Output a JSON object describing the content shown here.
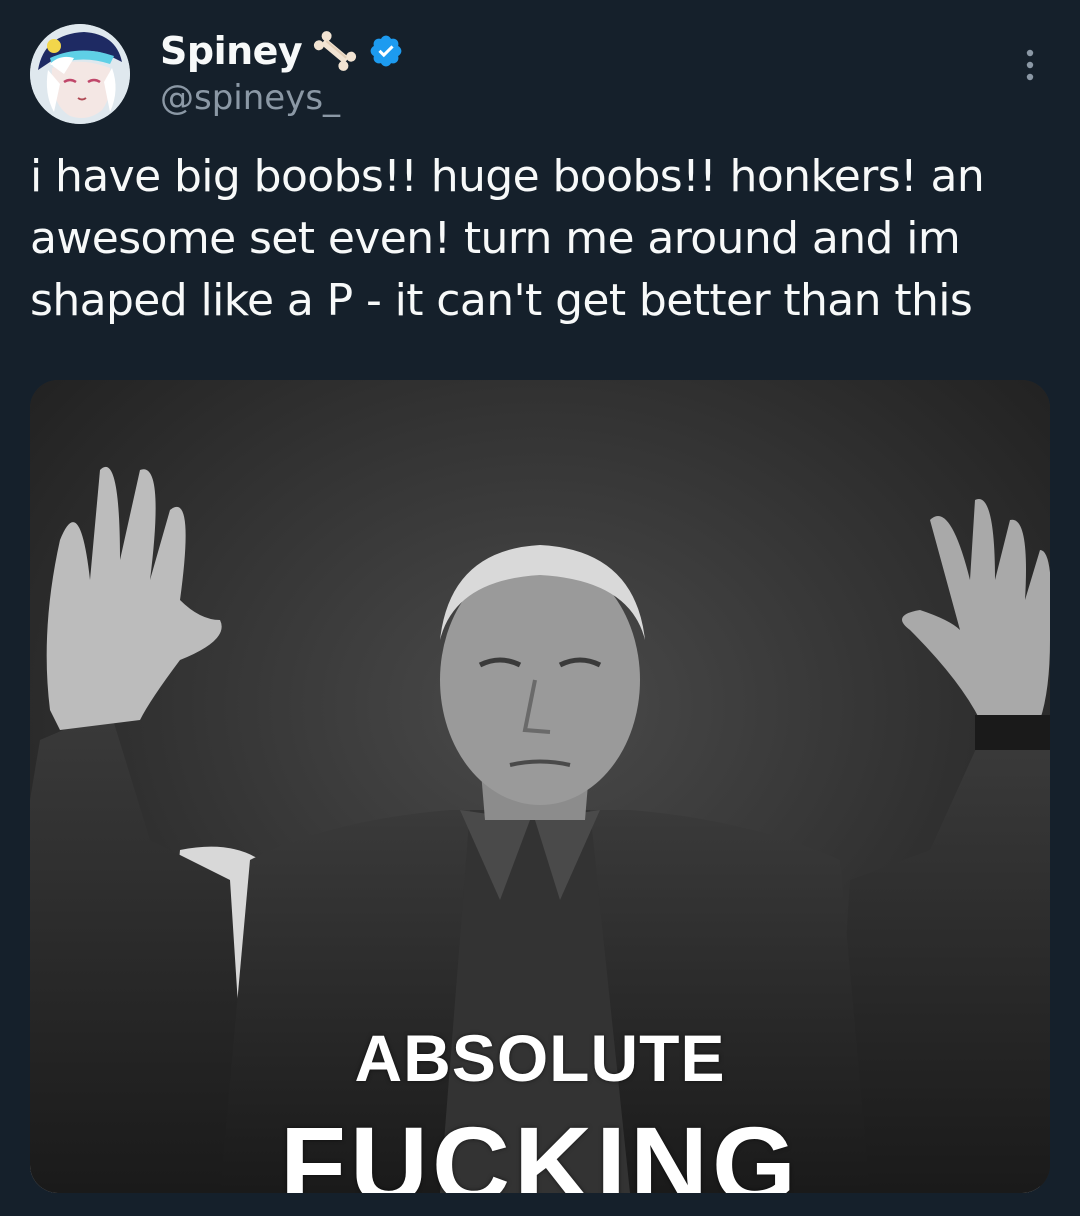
{
  "author": {
    "display_name": "Spiney",
    "handle": "@spineys_",
    "avatar_icon": "anime-avatar",
    "badge_icon": "bone-emoji",
    "verified_icon": "verified-badge-icon",
    "verified_color": "#1d9bf0"
  },
  "tweet": {
    "text": "i have big boobs!! huge boobs!! honkers! an awesome set even! turn me around and im shaped like a P - it can't get better than this"
  },
  "media": {
    "caption_line1": "ABSOLUTE",
    "caption_line2": "FUCKING"
  },
  "menu": {
    "icon": "more-options-icon"
  },
  "colors": {
    "background": "#15202b",
    "text_primary": "#f7f9f9",
    "text_secondary": "#8b98a5"
  }
}
